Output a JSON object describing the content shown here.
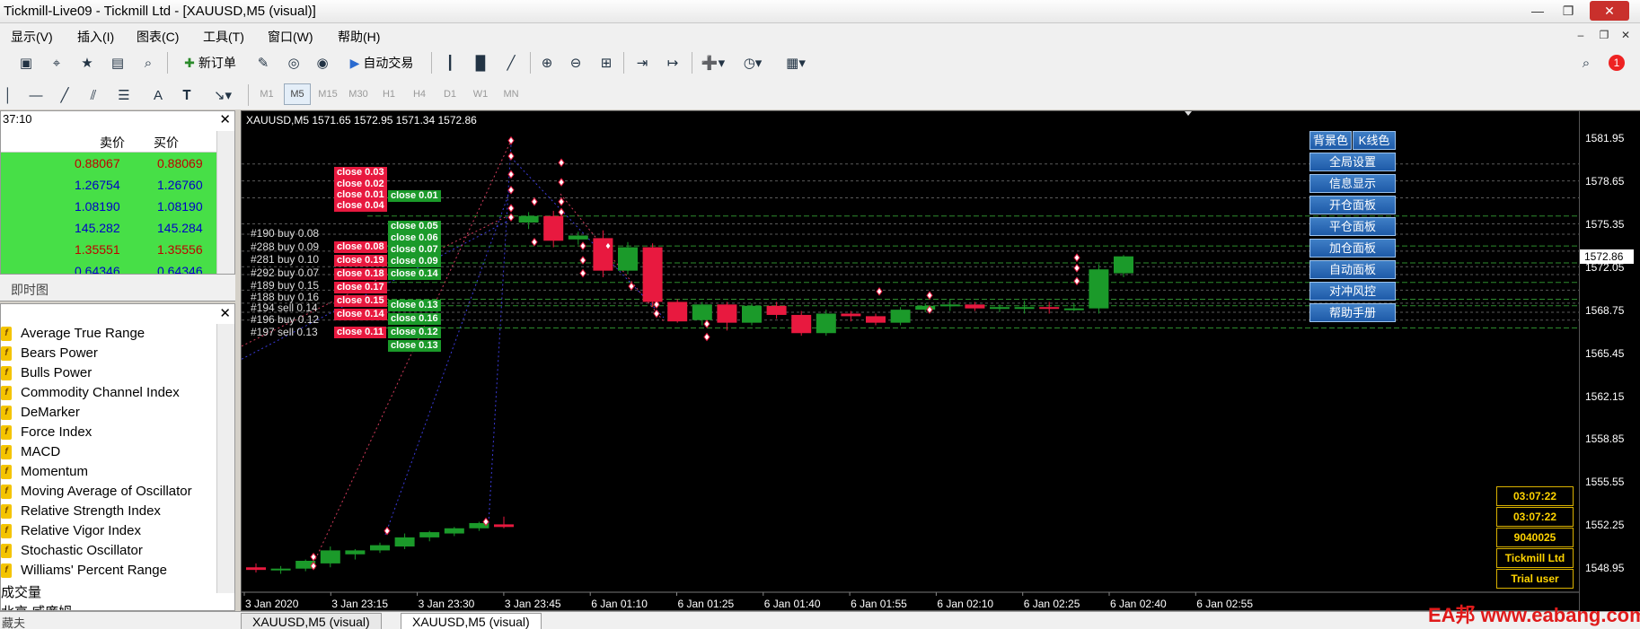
{
  "window": {
    "title": "Tickmill-Live09 - Tickmill Ltd - [XAUUSD,M5 (visual)]"
  },
  "menu": [
    "显示(V)",
    "插入(I)",
    "图表(C)",
    "工具(T)",
    "窗口(W)",
    "帮助(H)"
  ],
  "toolbar": {
    "new_order": "新订单",
    "auto_trading": "自动交易",
    "notification_count": "1",
    "timeframes": [
      "M1",
      "M5",
      "M15",
      "M30",
      "H1",
      "H4",
      "D1",
      "W1",
      "MN"
    ],
    "active_timeframe": "M5"
  },
  "market_watch": {
    "time": "37:10",
    "col_bid": "卖价",
    "col_ask": "买价",
    "rows": [
      {
        "bid": "0.88067",
        "ask": "0.88069",
        "color": "#c00000"
      },
      {
        "bid": "1.26754",
        "ask": "1.26760",
        "color": "#0000c8"
      },
      {
        "bid": "1.08190",
        "ask": "1.08190",
        "color": "#0000c8"
      },
      {
        "bid": "145.282",
        "ask": "145.284",
        "color": "#0000c8"
      },
      {
        "bid": "1.35551",
        "ask": "1.35556",
        "color": "#c00000"
      },
      {
        "bid": "0.64346",
        "ask": "0.64346",
        "color": "#0000c8"
      }
    ],
    "tab": "即时图"
  },
  "navigator": {
    "items": [
      "Average True Range",
      "Bears Power",
      "Bulls Power",
      "Commodity Channel Index",
      "DeMarker",
      "Force Index",
      "MACD",
      "Momentum",
      "Moving Average of Oscillator",
      "Relative Strength Index",
      "Relative Vigor Index",
      "Stochastic Oscillator",
      "Williams' Percent Range"
    ],
    "extra": [
      "成交量",
      "北京 威廉姆"
    ]
  },
  "bottom": {
    "left_text": "藏夫",
    "tabs": [
      "XAUUSD,M5 (visual)",
      "XAUUSD,M5 (visual)"
    ]
  },
  "chart": {
    "info": "XAUUSD,M5  1571.65 1572.95 1571.34 1572.86",
    "current_price": "1572.86",
    "price_labels": [
      "1581.95",
      "1578.65",
      "1575.35",
      "1572.05",
      "1568.75",
      "1565.45",
      "1562.15",
      "1558.85",
      "1555.55",
      "1552.25",
      "1548.95"
    ],
    "time_labels": [
      "3 Jan 2020",
      "3 Jan 23:15",
      "3 Jan 23:30",
      "3 Jan 23:45",
      "6 Jan 01:10",
      "6 Jan 01:25",
      "6 Jan 01:40",
      "6 Jan 01:55",
      "6 Jan 02:10",
      "6 Jan 02:25",
      "6 Jan 02:40",
      "6 Jan 02:55"
    ],
    "close_red": [
      "close 0.03",
      "close 0.02",
      "close 0.01",
      "close 0.04",
      "close 0.08",
      "close 0.19",
      "close 0.18",
      "close 0.17",
      "close 0.15",
      "close 0.14",
      "close 0.11"
    ],
    "close_green": [
      "close 0.01",
      "close 0.05",
      "close 0.06",
      "close 0.07",
      "close 0.09",
      "close 0.14",
      "close 0.13",
      "close 0.16",
      "close 0.12",
      "close 0.13"
    ],
    "orders": [
      "#190 buy 0.08",
      "#288 buy 0.09",
      "#281 buy 0.10",
      "#292 buy 0.07",
      "#189 buy 0.15",
      "#188 buy 0.16",
      "#194 sell 0.14",
      "#196 buy 0.12",
      "#197 sell 0.13"
    ],
    "panel_buttons": [
      "背景色",
      "K线色",
      "全局设置",
      "信息显示",
      "开仓面板",
      "平仓面板",
      "加仓面板",
      "自动面板",
      "对冲风控",
      "帮助手册"
    ],
    "info_boxes": [
      "03:07:22",
      "03:07:22",
      "9040025",
      "Tickmill Ltd",
      "Trial user"
    ],
    "colors": {
      "bull": "#1b9a2a",
      "bear": "#e8193f",
      "grid_green": "#2e8b2e",
      "grid_gray": "#5a5a5a"
    }
  },
  "chart_data": {
    "type": "candlestick",
    "symbol": "XAUUSD",
    "timeframe": "M5",
    "ylim": [
      1547.5,
      1583.5
    ],
    "candles": [
      {
        "o": 1549.0,
        "h": 1549.3,
        "l": 1548.6,
        "c": 1548.8
      },
      {
        "o": 1548.8,
        "h": 1549.1,
        "l": 1548.5,
        "c": 1548.9
      },
      {
        "o": 1548.9,
        "h": 1549.6,
        "l": 1548.7,
        "c": 1549.5
      },
      {
        "o": 1549.3,
        "h": 1550.6,
        "l": 1549.0,
        "c": 1550.3
      },
      {
        "o": 1550.0,
        "h": 1550.4,
        "l": 1549.6,
        "c": 1550.3
      },
      {
        "o": 1550.3,
        "h": 1550.9,
        "l": 1550.1,
        "c": 1550.7
      },
      {
        "o": 1550.6,
        "h": 1551.6,
        "l": 1550.4,
        "c": 1551.3
      },
      {
        "o": 1551.3,
        "h": 1551.8,
        "l": 1551.0,
        "c": 1551.7
      },
      {
        "o": 1551.6,
        "h": 1552.1,
        "l": 1551.4,
        "c": 1552.0
      },
      {
        "o": 1552.0,
        "h": 1552.5,
        "l": 1551.8,
        "c": 1552.4
      },
      {
        "o": 1552.3,
        "h": 1552.9,
        "l": 1552.0,
        "c": 1552.1
      },
      {
        "o": 1575.5,
        "h": 1576.3,
        "l": 1575.0,
        "c": 1576.0
      },
      {
        "o": 1576.0,
        "h": 1576.4,
        "l": 1573.6,
        "c": 1574.1
      },
      {
        "o": 1574.2,
        "h": 1574.8,
        "l": 1573.8,
        "c": 1574.5
      },
      {
        "o": 1574.3,
        "h": 1574.9,
        "l": 1571.3,
        "c": 1571.8
      },
      {
        "o": 1571.8,
        "h": 1574.0,
        "l": 1571.5,
        "c": 1573.6
      },
      {
        "o": 1573.6,
        "h": 1573.9,
        "l": 1569.0,
        "c": 1569.4
      },
      {
        "o": 1569.4,
        "h": 1569.6,
        "l": 1567.8,
        "c": 1567.9
      },
      {
        "o": 1568.0,
        "h": 1569.4,
        "l": 1567.6,
        "c": 1569.2
      },
      {
        "o": 1569.2,
        "h": 1569.4,
        "l": 1567.2,
        "c": 1567.8
      },
      {
        "o": 1567.8,
        "h": 1569.3,
        "l": 1567.6,
        "c": 1569.1
      },
      {
        "o": 1569.1,
        "h": 1569.4,
        "l": 1568.1,
        "c": 1568.4
      },
      {
        "o": 1568.4,
        "h": 1568.7,
        "l": 1566.8,
        "c": 1567.0
      },
      {
        "o": 1567.0,
        "h": 1568.8,
        "l": 1566.8,
        "c": 1568.5
      },
      {
        "o": 1568.5,
        "h": 1568.7,
        "l": 1567.9,
        "c": 1568.3
      },
      {
        "o": 1568.3,
        "h": 1568.5,
        "l": 1567.6,
        "c": 1567.8
      },
      {
        "o": 1567.8,
        "h": 1569.0,
        "l": 1567.6,
        "c": 1568.8
      },
      {
        "o": 1568.8,
        "h": 1569.3,
        "l": 1568.6,
        "c": 1569.1
      },
      {
        "o": 1569.1,
        "h": 1569.6,
        "l": 1568.7,
        "c": 1569.2
      },
      {
        "o": 1569.2,
        "h": 1569.4,
        "l": 1568.7,
        "c": 1568.9
      },
      {
        "o": 1569.0,
        "h": 1569.2,
        "l": 1568.6,
        "c": 1569.0
      },
      {
        "o": 1569.0,
        "h": 1569.5,
        "l": 1568.5,
        "c": 1569.0
      },
      {
        "o": 1569.0,
        "h": 1569.4,
        "l": 1568.5,
        "c": 1568.9
      },
      {
        "o": 1568.9,
        "h": 1569.3,
        "l": 1568.7,
        "c": 1568.9
      },
      {
        "o": 1568.9,
        "h": 1572.3,
        "l": 1568.5,
        "c": 1571.9
      },
      {
        "o": 1571.6,
        "h": 1573.0,
        "l": 1571.3,
        "c": 1572.9
      }
    ]
  }
}
